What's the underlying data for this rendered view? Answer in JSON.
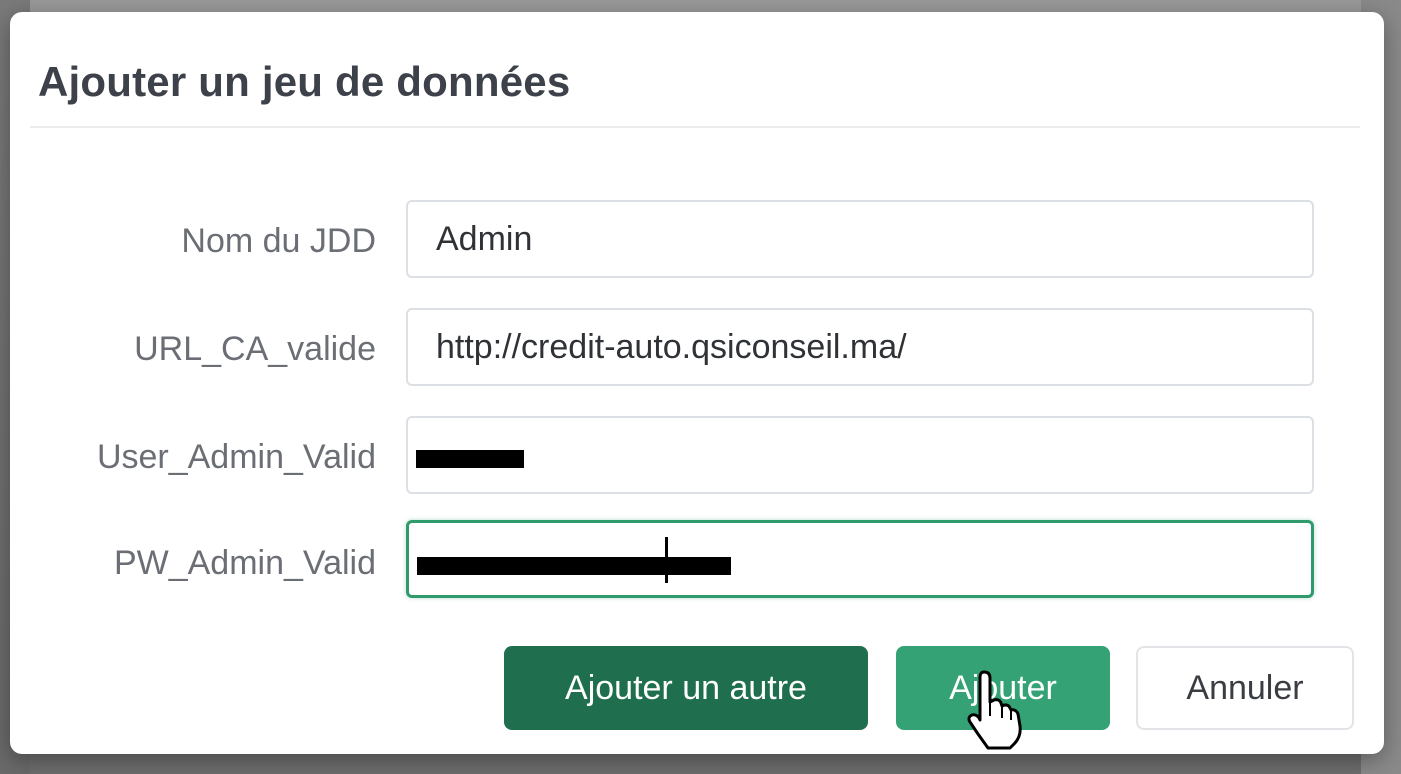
{
  "dialog": {
    "title": "Ajouter un jeu de données",
    "fields": [
      {
        "label": "Nom du JDD",
        "value": "Admin"
      },
      {
        "label": "URL_CA_valide",
        "value": "http://credit-auto.qsiconseil.ma/"
      },
      {
        "label": "User_Admin_Valid",
        "value": ""
      },
      {
        "label": "PW_Admin_Valid",
        "value": ""
      }
    ],
    "buttons": {
      "add_another": "Ajouter un autre",
      "add": "Ajouter",
      "cancel": "Annuler"
    }
  },
  "colors": {
    "primary_dark": "#1f6e4d",
    "primary": "#35a276",
    "focus_border": "#2f9a6b"
  },
  "icons": {
    "cursor": "hand-pointer-icon"
  }
}
